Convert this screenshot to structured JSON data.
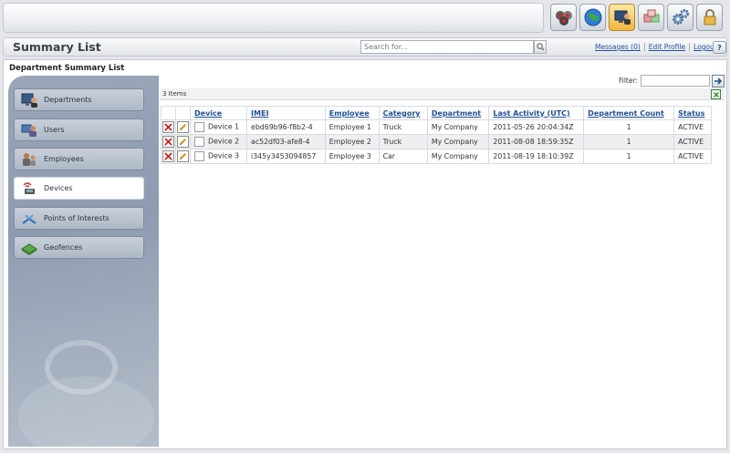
{
  "toolbar": {
    "icons": [
      "devices-group-icon",
      "globe-map-icon",
      "monitor-user-icon",
      "cubes-icon",
      "gears-icon",
      "padlock-icon"
    ],
    "active_index": 2
  },
  "header": {
    "title": "Summary List",
    "search_placeholder": "Search for...",
    "links": {
      "messages": "Messages (0)",
      "edit_profile": "Edit Profile",
      "logout": "Logout"
    },
    "help_label": "?"
  },
  "content": {
    "section_title": "Department Summary List"
  },
  "sidebar": {
    "items": [
      {
        "label": "Departments",
        "icon": "departments-icon"
      },
      {
        "label": "Users",
        "icon": "users-icon"
      },
      {
        "label": "Employees",
        "icon": "employees-icon"
      },
      {
        "label": "Devices",
        "icon": "devices-icon"
      },
      {
        "label": "Points of Interests",
        "icon": "points-of-interests-icon"
      },
      {
        "label": "Geofences",
        "icon": "geofences-icon"
      }
    ],
    "active_index": 3
  },
  "grid": {
    "items_count": "3 Items",
    "filter_label": "Filter:",
    "columns": [
      "Device",
      "IMEI",
      "Employee",
      "Category",
      "Department",
      "Last Activity (UTC)",
      "Department Count",
      "Status"
    ],
    "rows": [
      [
        "Device 1",
        "ebd69b96-f8b2-4",
        "Employee 1",
        "Truck",
        "My Company",
        "2011-05-26 20:04:34Z",
        "1",
        "ACTIVE"
      ],
      [
        "Device 2",
        "ac52df03-afe8-4",
        "Employee 2",
        "Truck",
        "My Company",
        "2011-08-08 18:59:35Z",
        "1",
        "ACTIVE"
      ],
      [
        "Device 3",
        "i345y3453094857",
        "Employee 3",
        "Car",
        "My Company",
        "2011-08-19 18:10:39Z",
        "1",
        "ACTIVE"
      ]
    ]
  },
  "colors": {
    "link": "#2255a0",
    "header_link": "#1f4f91",
    "delete": "#cc1111",
    "sidebar": "#9aa6b8"
  }
}
